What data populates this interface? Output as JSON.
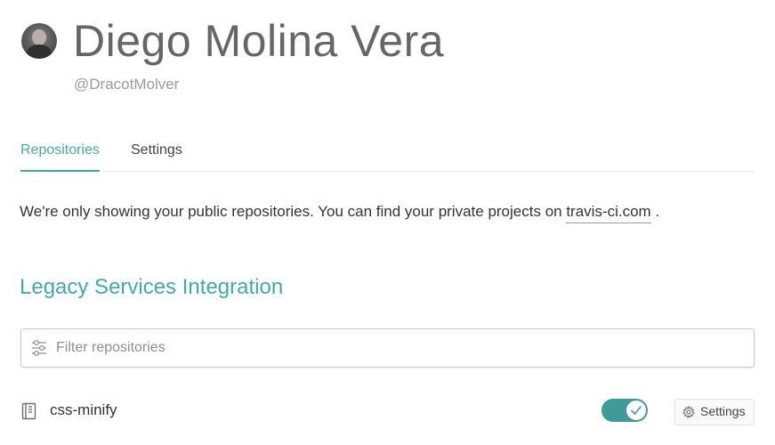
{
  "profile": {
    "name": "Diego Molina Vera",
    "handle": "@DracotMolver"
  },
  "tabs": [
    {
      "label": "Repositories",
      "active": true
    },
    {
      "label": "Settings",
      "active": false
    }
  ],
  "notice": {
    "text": "We're only showing your public repositories. You can find your private projects on ",
    "link_text": "travis-ci.com",
    "suffix": " ."
  },
  "section": {
    "title": "Legacy Services Integration"
  },
  "filter": {
    "placeholder": "Filter repositories",
    "value": ""
  },
  "repositories": [
    {
      "name": "css-minify",
      "enabled": true,
      "settings_label": "Settings"
    }
  ],
  "colors": {
    "accent": "#3eaaaf",
    "toggle_on": "#3f9a9a",
    "text": "#333333",
    "muted": "#9a9a9a"
  },
  "icons": {
    "avatar": "user-avatar",
    "filter": "sliders-icon",
    "repo": "repo-book-icon",
    "toggle": "checkmark-icon",
    "settings": "gear-icon"
  }
}
